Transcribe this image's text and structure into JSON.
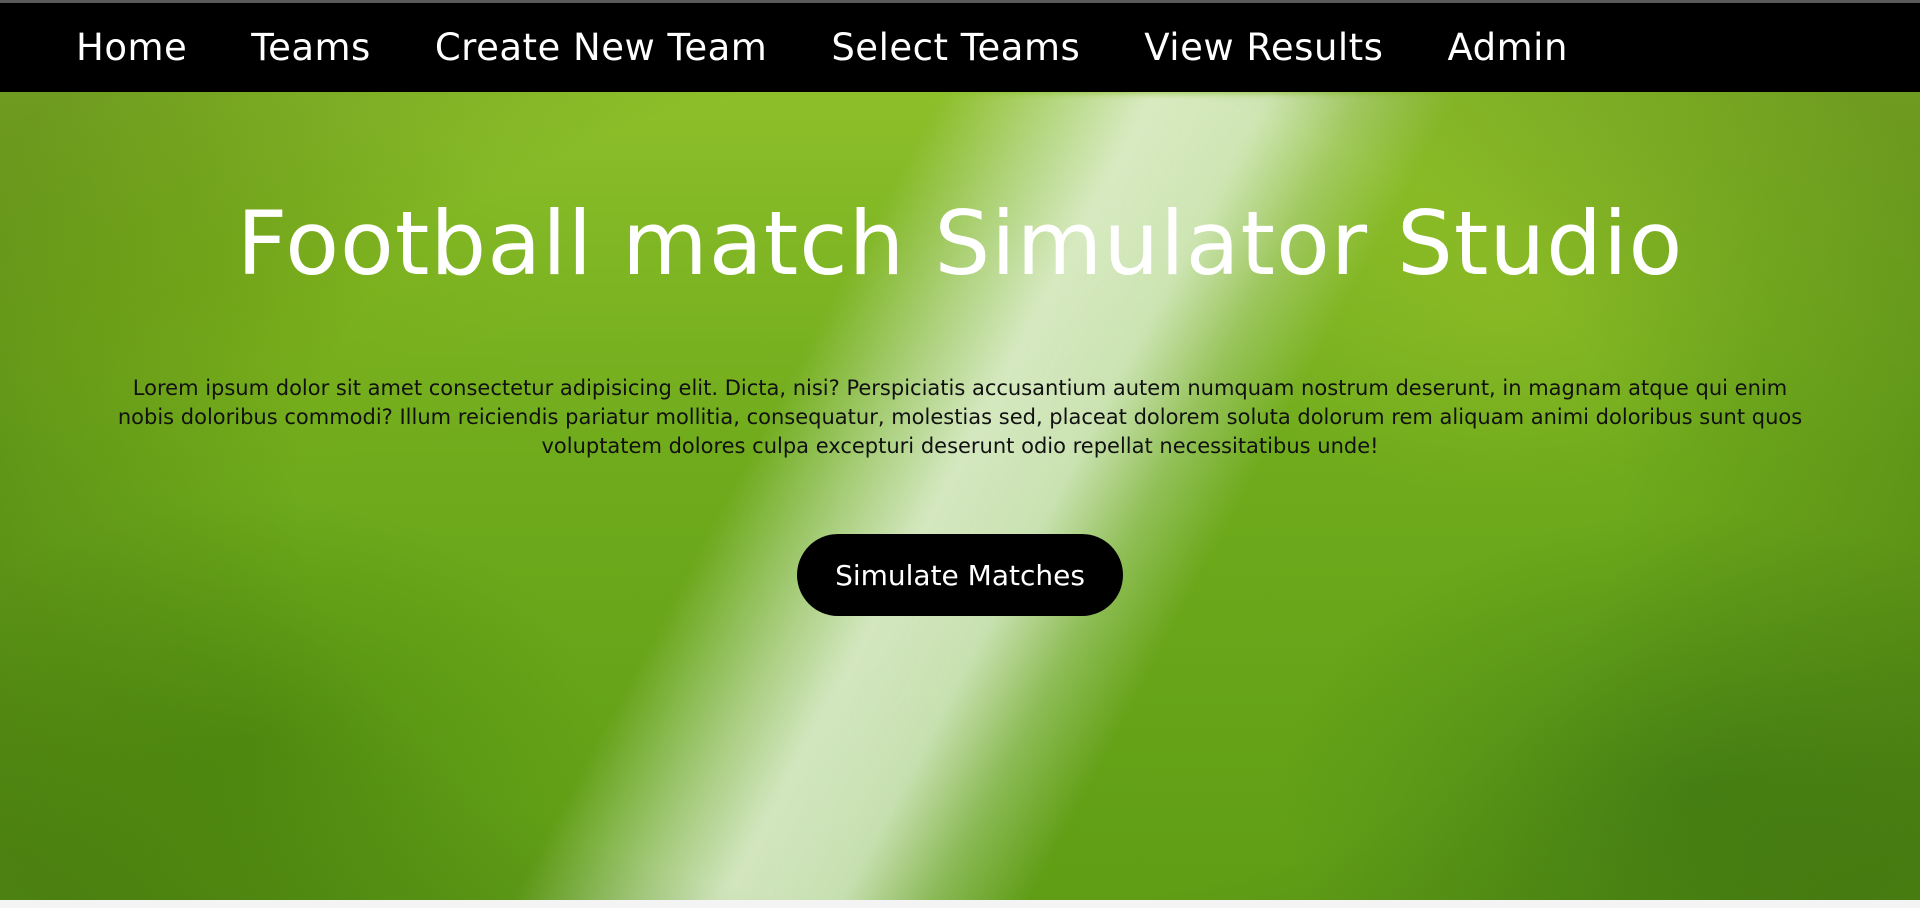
{
  "nav": {
    "items": [
      {
        "label": "Home"
      },
      {
        "label": "Teams"
      },
      {
        "label": "Create New Team"
      },
      {
        "label": "Select Teams"
      },
      {
        "label": "View Results"
      },
      {
        "label": "Admin"
      }
    ]
  },
  "hero": {
    "title": "Football match Simulator Studio",
    "text": "Lorem ipsum dolor sit amet consectetur adipisicing elit. Dicta, nisi? Perspiciatis accusantium autem numquam nostrum deserunt, in magnam atque qui enim nobis doloribus commodi? Illum reiciendis pariatur mollitia, consequatur, molestias sed, placeat dolorem soluta dolorum rem aliquam animi doloribus sunt quos voluptatem dolores culpa excepturi deserunt odio repellat necessitatibus unde!",
    "button_label": "Simulate Matches"
  },
  "colors": {
    "navbar_bg": "#000000",
    "nav_text": "#ffffff",
    "button_bg": "#000000",
    "button_text": "#ffffff",
    "grass": "#6fab1c"
  }
}
